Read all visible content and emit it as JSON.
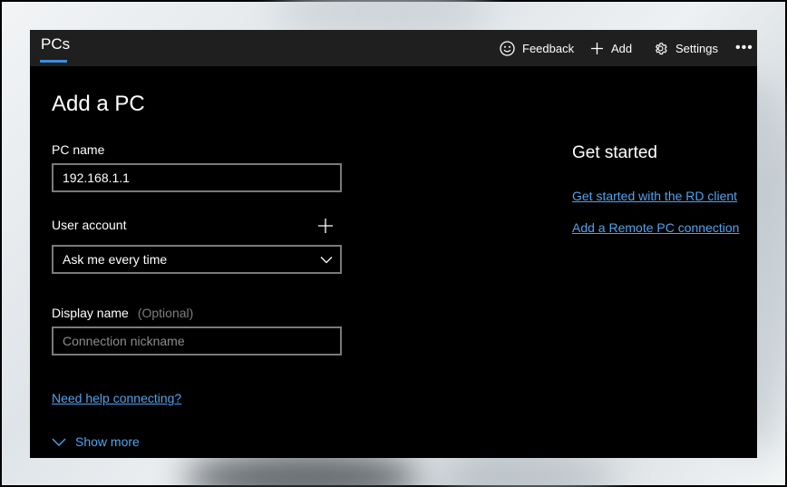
{
  "titlebar": {
    "tab_label": "PCs",
    "feedback_label": "Feedback",
    "add_label": "Add",
    "settings_label": "Settings",
    "more_label": "•••"
  },
  "form": {
    "title": "Add a PC",
    "pc_name_label": "PC name",
    "pc_name_value": "192.168.1.1",
    "user_account_label": "User account",
    "user_account_value": "Ask me every time",
    "display_name_label": "Display name",
    "display_name_optional": "(Optional)",
    "display_name_placeholder": "Connection nickname",
    "help_link": "Need help connecting?",
    "show_more": "Show more"
  },
  "side": {
    "title": "Get started",
    "links": [
      "Get started with the RD client",
      "Add a Remote PC connection"
    ]
  },
  "icons": {
    "feedback": "smiley-icon",
    "add": "plus-icon",
    "settings": "gear-icon",
    "more": "more-icon",
    "dropdown": "chevron-down-icon",
    "show_more": "chevron-down-icon"
  },
  "colors": {
    "accent": "#3a8fe0",
    "link": "#4fa3f0",
    "titlebar": "#1f1f1f",
    "background": "#000000"
  }
}
